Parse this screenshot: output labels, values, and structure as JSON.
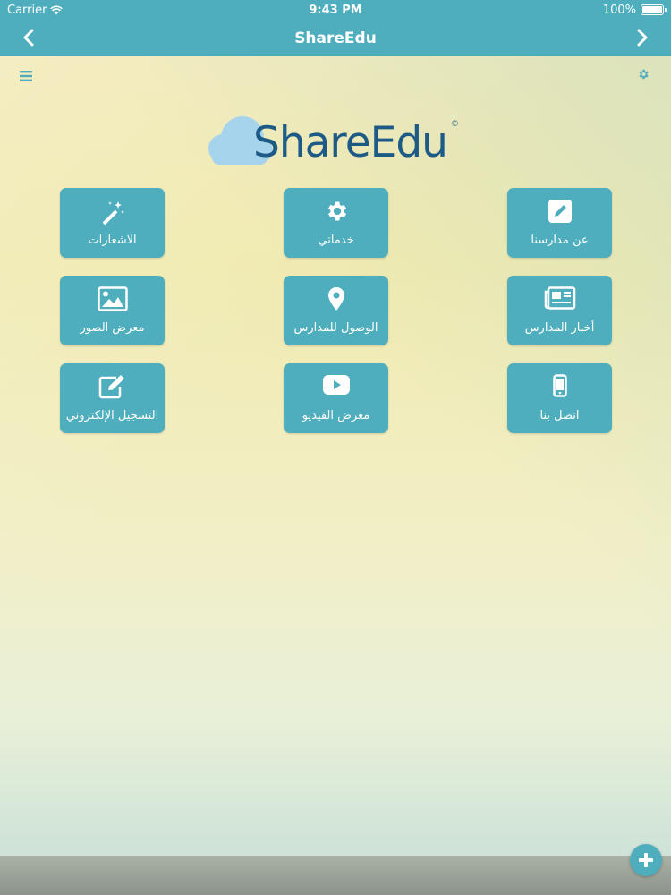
{
  "status_bar": {
    "carrier": "Carrier",
    "time": "9:43 PM",
    "battery": "100%",
    "battery_level": 1.0
  },
  "nav": {
    "title": "ShareEdu",
    "back_icon": "chevron-left-icon",
    "forward_icon": "chevron-right-icon"
  },
  "toolbar": {
    "menu_icon": "hamburger-menu-icon",
    "settings_icon": "gear-icon"
  },
  "logo": {
    "text": "ShareEdu",
    "mark": "©"
  },
  "tiles": [
    {
      "label": "الاشعارات",
      "icon": "magic-wand-icon"
    },
    {
      "label": "خدماتي",
      "icon": "gear-icon"
    },
    {
      "label": "عن مدارسنا",
      "icon": "edit-icon"
    },
    {
      "label": "معرض الصور",
      "icon": "image-icon"
    },
    {
      "label": "الوصول للمدارس",
      "icon": "map-marker-icon"
    },
    {
      "label": "أخبار المدارس",
      "icon": "newspaper-icon"
    },
    {
      "label": "التسجيل الإلكتروني",
      "icon": "pencil-square-icon"
    },
    {
      "label": "معرض الفيديو",
      "icon": "youtube-play-icon"
    },
    {
      "label": "اتصل بنا",
      "icon": "mobile-phone-icon"
    }
  ],
  "fab": {
    "icon": "plus-icon"
  },
  "colors": {
    "accent": "#4eaebe",
    "logo_text": "#1d5b86",
    "cloud": "#a6d4ec"
  }
}
